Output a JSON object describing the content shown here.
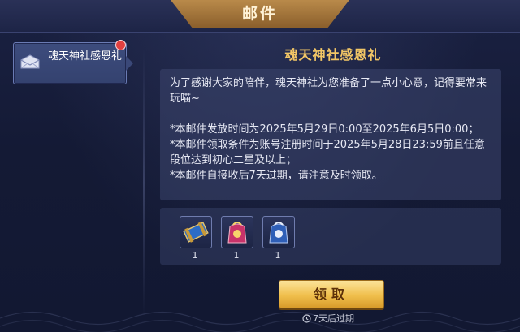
{
  "window": {
    "title": "邮件"
  },
  "sidebar": {
    "items": [
      {
        "label": "魂天神社感恩礼",
        "unread": true
      }
    ]
  },
  "mail": {
    "title": "魂天神社感恩礼",
    "body": [
      "为了感谢大家的陪伴，魂天神社为您准备了一点小心意，记得要常来玩喵~",
      "",
      "*本邮件发放时间为2025年5月29日0:00至2025年6月5日0:00；",
      "*本邮件领取条件为账号注册时间于2025年5月28日23:59前且任意段位达到初心二星及以上；",
      "*本邮件自接收后7天过期，请注意及时领取。"
    ],
    "rewards": [
      {
        "icon": "scroll-icon",
        "count": "1"
      },
      {
        "icon": "red-gift-bag-icon",
        "count": "1"
      },
      {
        "icon": "blue-gift-bag-icon",
        "count": "1"
      }
    ],
    "claim_label": "领取",
    "expire_text": "7天后过期"
  },
  "colors": {
    "background": "#141a33",
    "title_accent": "#f3c766",
    "button": "#f0bf4c",
    "unread_dot": "#e24040"
  }
}
